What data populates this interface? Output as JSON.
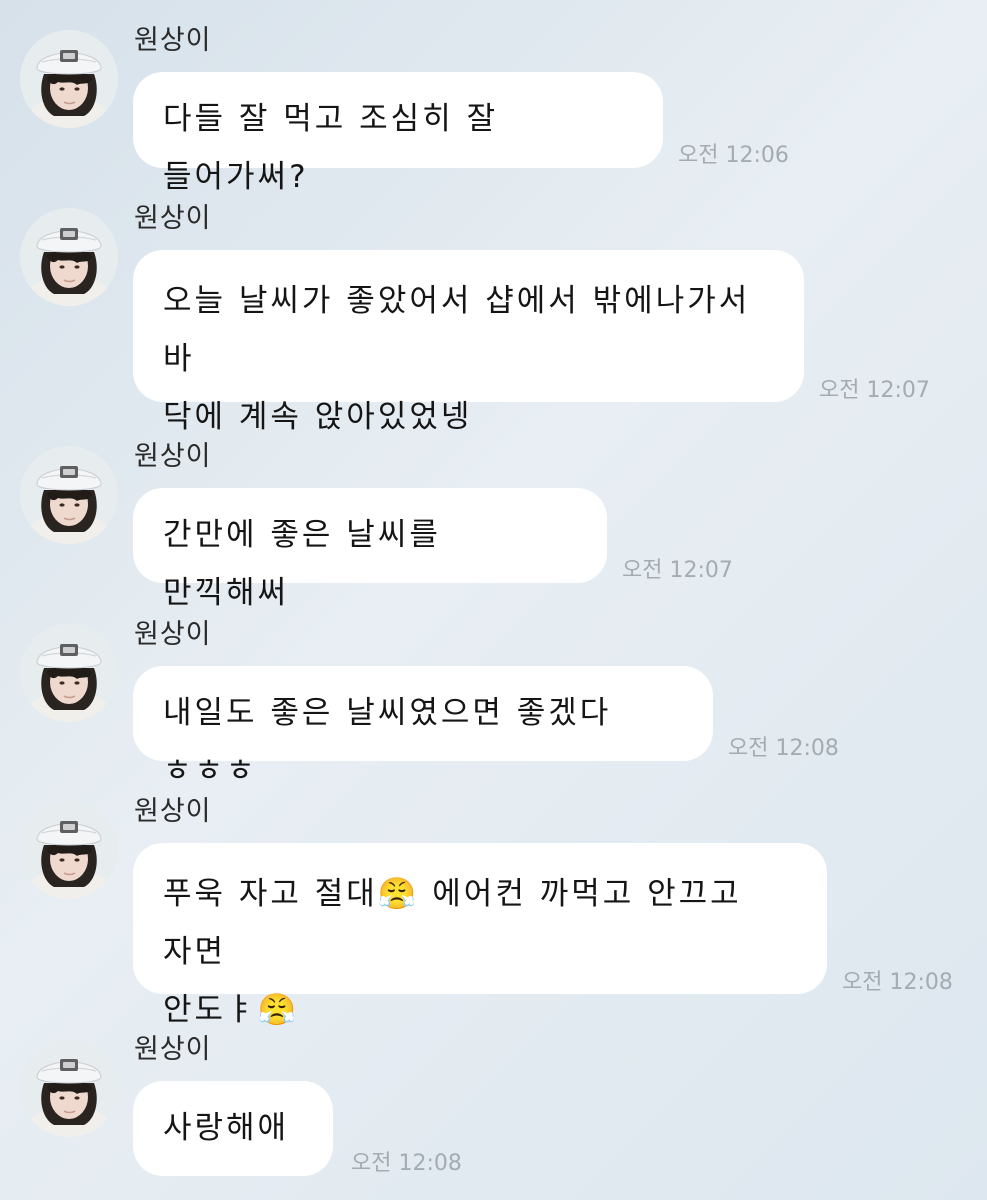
{
  "messages": [
    {
      "sender": "원상이",
      "lines": [
        "다들 잘 먹고 조심히 잘 들어가써?"
      ],
      "time": "오전 12:06"
    },
    {
      "sender": "원상이",
      "lines": [
        "오늘 날씨가 좋았어서 샵에서 밖에나가서 바",
        "닥에 계속 앉아있었넹"
      ],
      "time": "오전 12:07"
    },
    {
      "sender": "원상이",
      "lines": [
        "간만에 좋은 날씨를 만끽해써"
      ],
      "time": "오전 12:07"
    },
    {
      "sender": "원상이",
      "lines": [
        "내일도 좋은 날씨였으면 좋겠다 ㅎㅎㅎ"
      ],
      "time": "오전 12:08"
    },
    {
      "sender": "원상이",
      "lines": [
        "푸욱 자고 절대😤 에어컨 까먹고 안끄고 자면",
        "안도ㅑ😤"
      ],
      "time": "오전 12:08"
    },
    {
      "sender": "원상이",
      "lines": [
        "사랑해애"
      ],
      "time": "오전 12:08"
    }
  ]
}
